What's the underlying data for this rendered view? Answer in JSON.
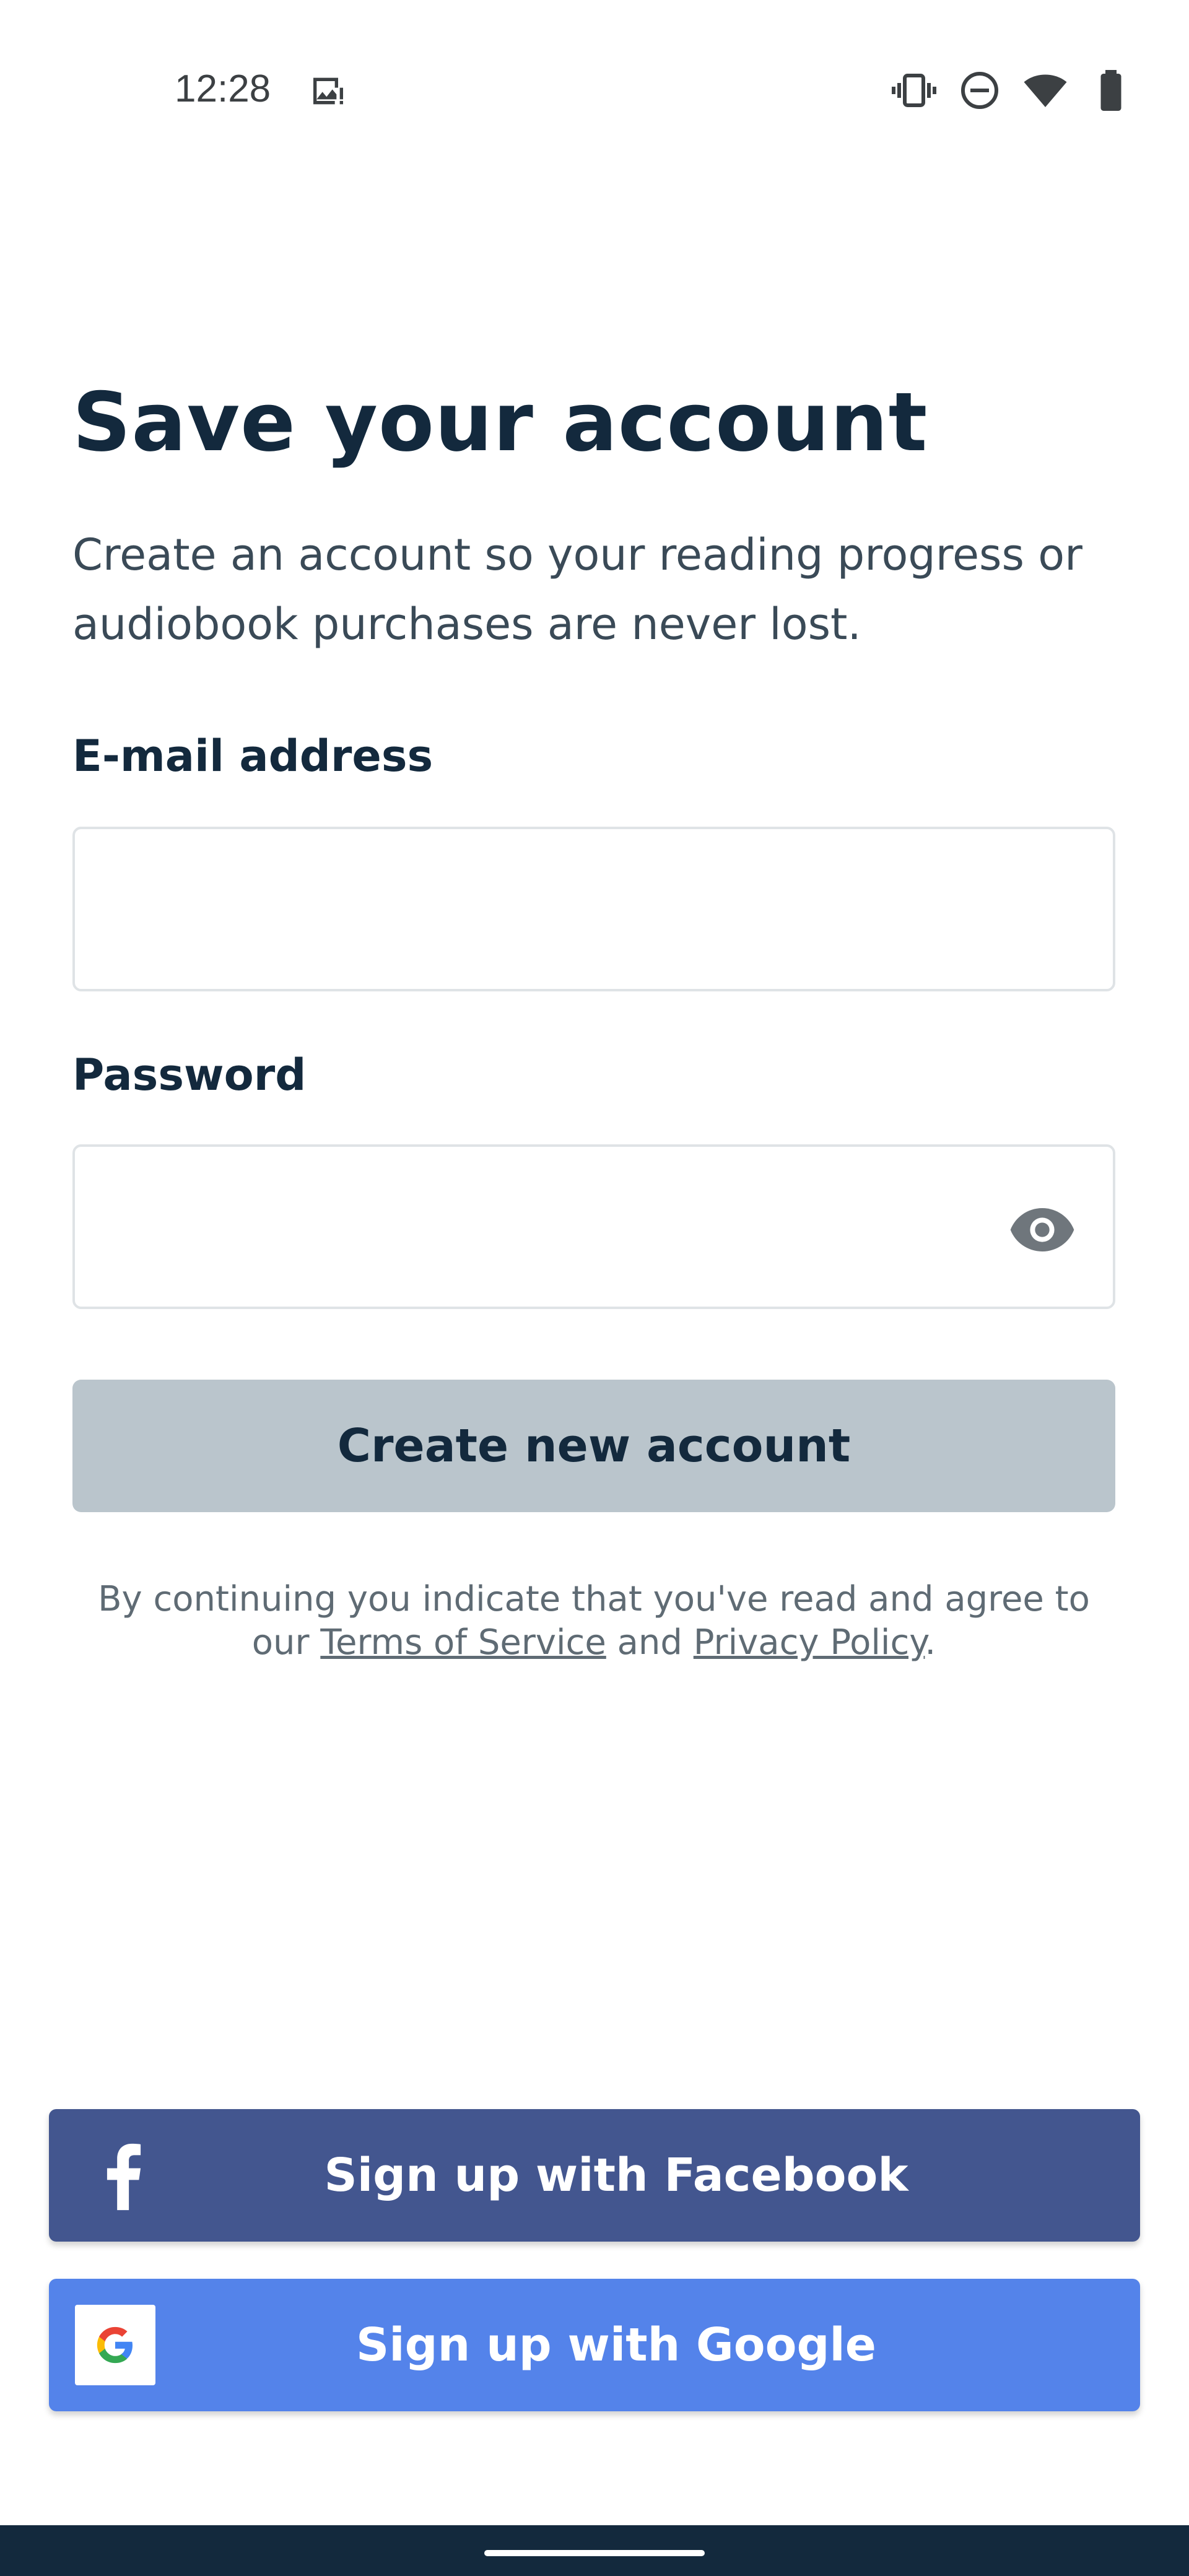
{
  "status_bar": {
    "time": "12:28",
    "left_icons": [
      "image-alert-icon"
    ],
    "right_icons": [
      "vibrate-icon",
      "do-not-disturb-icon",
      "wifi-icon",
      "battery-icon"
    ]
  },
  "header": {
    "title": "Save your account",
    "subtitle": "Create an account so your reading progress or audiobook purchases are never lost."
  },
  "form": {
    "email": {
      "label": "E-mail address",
      "value": "",
      "placeholder": ""
    },
    "password": {
      "label": "Password",
      "value": "",
      "placeholder": "",
      "toggle_icon": "eye-icon"
    },
    "submit_label": "Create new account"
  },
  "legal": {
    "prefix": "By continuing you indicate that you've read and agree to our ",
    "terms_label": "Terms of Service",
    "middle": " and ",
    "privacy_label": "Privacy Policy",
    "suffix": "."
  },
  "social": {
    "facebook_label": "Sign up with Facebook",
    "google_label": "Sign up with Google"
  },
  "colors": {
    "text_primary": "#13293d",
    "button_disabled": "#bac5cc",
    "facebook": "#43568f",
    "google": "#5483ea",
    "nav_bar": "#13293d"
  }
}
